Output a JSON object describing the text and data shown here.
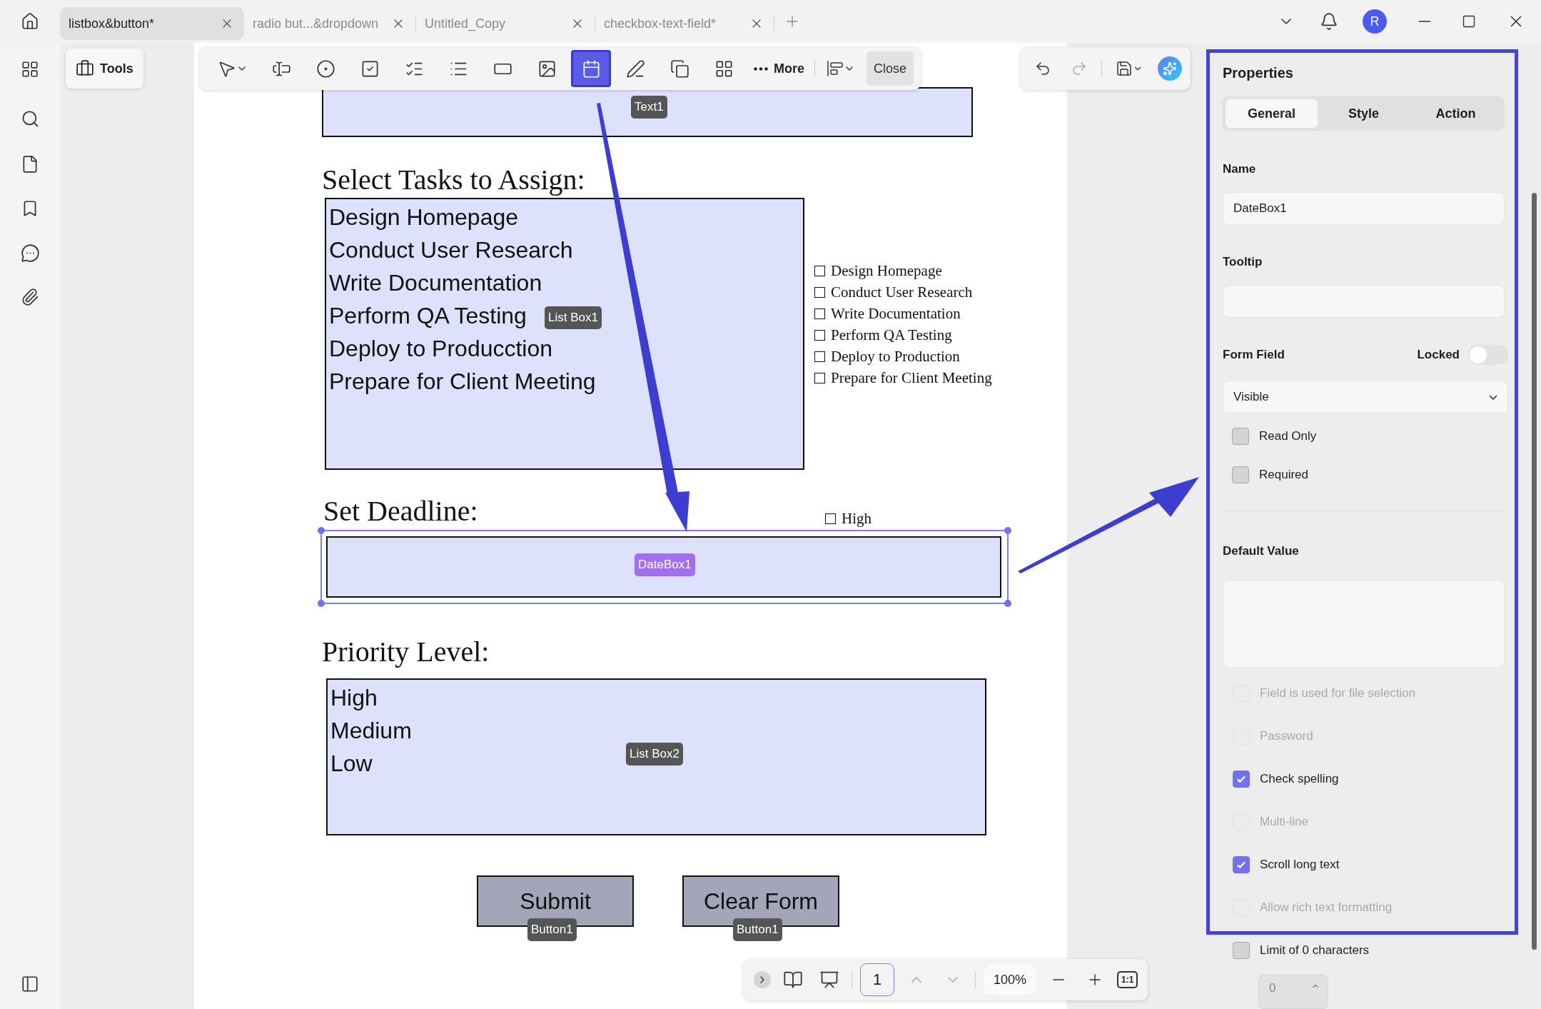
{
  "tabs": [
    {
      "title": "listbox&button*",
      "selected": true
    },
    {
      "title": "radio but...&dropdown",
      "selected": false
    },
    {
      "title": "Untitled_Copy",
      "selected": false
    },
    {
      "title": "checkbox-text-field*",
      "selected": false
    }
  ],
  "avatar": "R",
  "tools_button": "Tools",
  "toolbar": {
    "tools": [
      {
        "kind": "pointer",
        "selected": false
      },
      {
        "kind": "text-field",
        "selected": false
      },
      {
        "kind": "radio",
        "selected": false
      },
      {
        "kind": "checkbox",
        "selected": false
      },
      {
        "kind": "combo",
        "selected": false
      },
      {
        "kind": "list",
        "selected": false
      },
      {
        "kind": "button",
        "selected": false
      },
      {
        "kind": "image",
        "selected": false
      },
      {
        "kind": "date",
        "selected": true
      },
      {
        "kind": "signature",
        "selected": false
      },
      {
        "kind": "copy",
        "selected": false
      },
      {
        "kind": "grid",
        "selected": false
      }
    ],
    "more": "More",
    "close": "Close"
  },
  "document": {
    "text_field": {
      "badge": "Text1"
    },
    "tasks": {
      "heading": "Select Tasks to Assign:",
      "list_box": {
        "badge": "List Box1",
        "items": [
          "Design Homepage",
          "Conduct User Research",
          "Write Documentation",
          "Perform QA Testing",
          "Deploy to Producction",
          "Prepare for Client Meeting"
        ]
      },
      "checkboxes": [
        {
          "label": "Design Homepage",
          "checked": false
        },
        {
          "label": "Conduct User Research",
          "checked": false
        },
        {
          "label": "Write Documentation",
          "checked": false
        },
        {
          "label": "Perform QA Testing",
          "checked": false
        },
        {
          "label": "Deploy to Production",
          "checked": false
        },
        {
          "label": "Prepare for Client Meeting",
          "checked": false
        }
      ]
    },
    "deadline": {
      "heading": "Set Deadline:",
      "checkbox": {
        "label": "High",
        "checked": false
      },
      "date_box": {
        "badge": "DateBox1",
        "selected": true
      }
    },
    "priority": {
      "heading": "Priority Level:",
      "list_box": {
        "badge": "List Box2",
        "items": [
          "High",
          "Medium",
          "Low"
        ]
      }
    },
    "buttons": [
      {
        "label": "Submit",
        "badge": "Button1"
      },
      {
        "label": "Clear Form",
        "badge": "Button1"
      }
    ]
  },
  "properties": {
    "title": "Properties",
    "tabs": [
      {
        "label": "General",
        "selected": true
      },
      {
        "label": "Style",
        "selected": false
      },
      {
        "label": "Action",
        "selected": false
      }
    ],
    "name_label": "Name",
    "name_value": "DateBox1",
    "tooltip_label": "Tooltip",
    "form_field_label": "Form Field",
    "locked_label": "Locked",
    "locked": false,
    "visibility": "Visible",
    "options": [
      {
        "label": "Read Only",
        "checked": false,
        "disabled": false
      },
      {
        "label": "Required",
        "checked": false,
        "disabled": false
      }
    ],
    "default_value_label": "Default Value",
    "field_options": [
      {
        "label": "Field is used for file selection",
        "checked": false,
        "disabled": true
      },
      {
        "label": "Password",
        "checked": false,
        "disabled": true
      },
      {
        "label": "Check spelling",
        "checked": true,
        "disabled": false
      },
      {
        "label": "Multi-line",
        "checked": false,
        "disabled": true
      },
      {
        "label": "Scroll long text",
        "checked": true,
        "disabled": false
      },
      {
        "label": "Allow rich text formatting",
        "checked": false,
        "disabled": true
      },
      {
        "label": "Limit of 0 characters",
        "checked": false,
        "disabled": false
      }
    ],
    "limit_value": "0"
  },
  "bottom_bar": {
    "page": "1",
    "zoom": "100%",
    "actual_size": "1:1"
  }
}
